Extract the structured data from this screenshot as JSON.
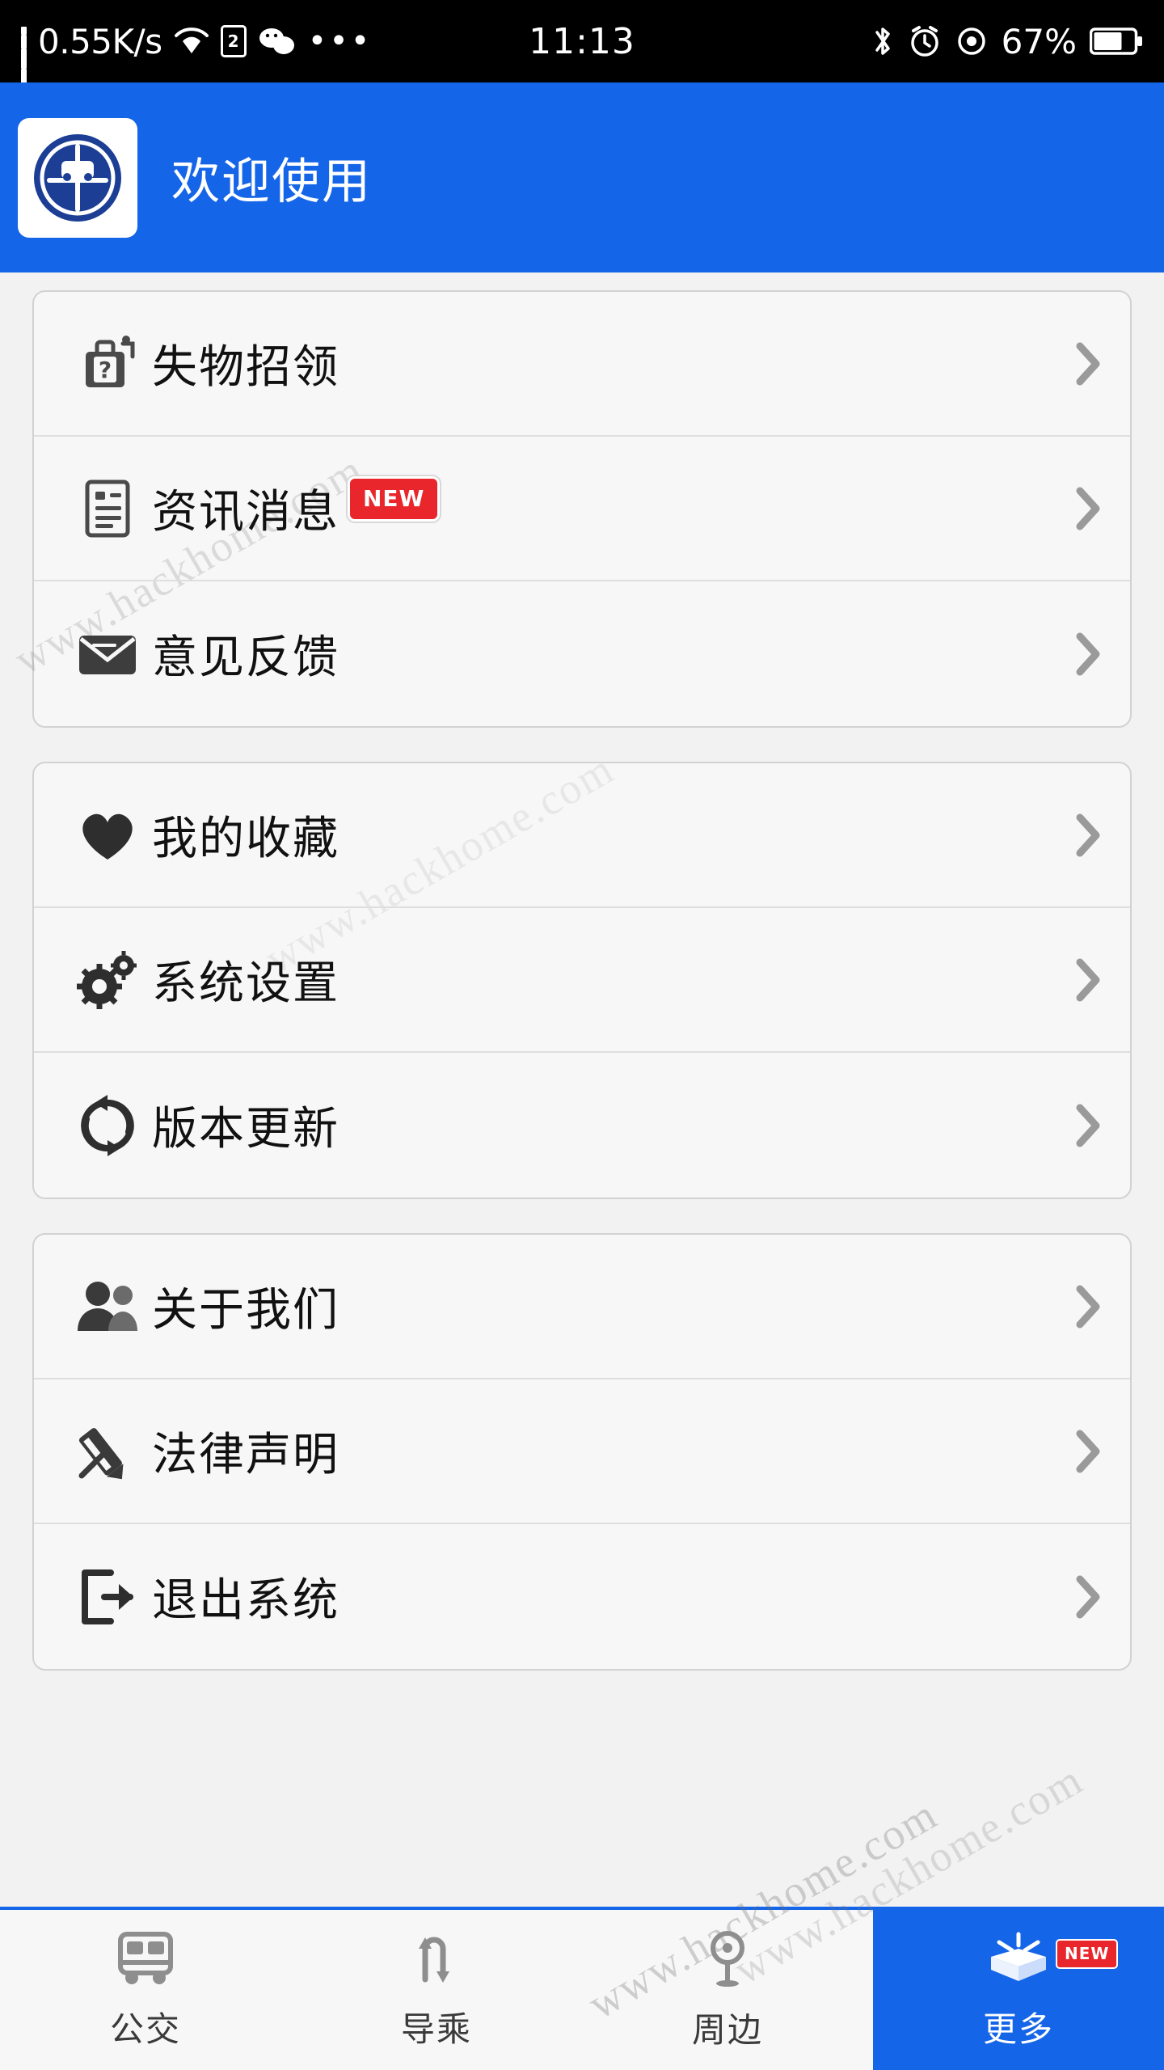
{
  "statusbar": {
    "network_speed": "0.55K/s",
    "signal_icon": "signal-bars-icon",
    "wifi_icon": "wifi-icon",
    "sim_icon": "sim-card-icon",
    "wechat_icon": "wechat-icon",
    "more_icon": "more-dots-icon",
    "time": "11:13",
    "bluetooth_icon": "bluetooth-icon",
    "alarm_icon": "alarm-clock-icon",
    "location_icon": "location-target-icon",
    "battery_percent": "67%",
    "battery_icon": "battery-icon"
  },
  "header": {
    "title": "欢迎使用",
    "logo_icon": "app-logo-icon",
    "background_color": "#1565e8"
  },
  "groups": [
    {
      "name": "services",
      "rows": [
        {
          "label": "失物招领",
          "icon": "lost-and-found-icon",
          "badge": "",
          "chevron": "chevron-right-icon"
        },
        {
          "label": "资讯消息",
          "icon": "news-document-icon",
          "badge": "NEW",
          "chevron": "chevron-right-icon"
        },
        {
          "label": "意见反馈",
          "icon": "feedback-envelope-icon",
          "badge": "",
          "chevron": "chevron-right-icon"
        }
      ]
    },
    {
      "name": "personal",
      "rows": [
        {
          "label": "我的收藏",
          "icon": "heart-icon",
          "badge": "",
          "chevron": "chevron-right-icon"
        },
        {
          "label": "系统设置",
          "icon": "gear-icon",
          "badge": "",
          "chevron": "chevron-right-icon"
        },
        {
          "label": "版本更新",
          "icon": "refresh-update-icon",
          "badge": "",
          "chevron": "chevron-right-icon"
        }
      ]
    },
    {
      "name": "info",
      "rows": [
        {
          "label": "关于我们",
          "icon": "users-icon",
          "badge": "",
          "chevron": "chevron-right-icon"
        },
        {
          "label": "法律声明",
          "icon": "legal-notice-icon",
          "badge": "",
          "chevron": "chevron-right-icon"
        },
        {
          "label": "退出系统",
          "icon": "exit-icon",
          "badge": "",
          "chevron": "chevron-right-icon"
        }
      ]
    }
  ],
  "tabbar": {
    "accent_color": "#1565e8",
    "tabs": [
      {
        "label": "公交",
        "icon": "bus-icon",
        "active": false,
        "badge": ""
      },
      {
        "label": "导乘",
        "icon": "transfer-arrows-icon",
        "active": false,
        "badge": ""
      },
      {
        "label": "周边",
        "icon": "map-pin-icon",
        "active": false,
        "badge": ""
      },
      {
        "label": "更多",
        "icon": "open-box-icon",
        "active": true,
        "badge": "NEW"
      }
    ]
  },
  "watermarks": {
    "text_a": "www.hackhome.com",
    "text_b": "www.hackhome.com",
    "text_c": "www.hackhome.com",
    "text_d": "www.hackhome.com"
  }
}
